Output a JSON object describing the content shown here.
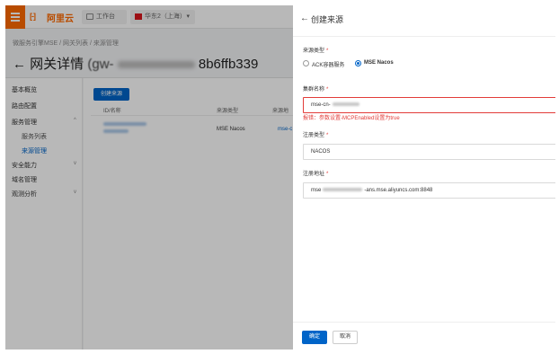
{
  "topbar": {
    "logo_mark": "[-]",
    "logo_text": "阿里云",
    "workbench": "工作台",
    "region": "华东2（上海）",
    "region_caret": "▾"
  },
  "breadcrumb": "微服务引擎MSE / 网关列表 / 来源管理",
  "page": {
    "back": "←",
    "title": "网关详情",
    "gateway_id_visible": "(gw-",
    "gateway_id_tail": "8b6ffb339"
  },
  "left_nav": {
    "items": [
      {
        "label": "基本概览"
      },
      {
        "label": "路由配置"
      },
      {
        "label": "服务管理",
        "caret": "^"
      },
      {
        "label": "服务列表"
      },
      {
        "label": "来源管理"
      },
      {
        "label": "安全能力",
        "caret": "v"
      },
      {
        "label": "域名管理"
      },
      {
        "label": "观测分析",
        "caret": "v"
      }
    ]
  },
  "content": {
    "create_button": "创建来源",
    "columns": [
      "ID/名称",
      "来源类型",
      "来源地"
    ],
    "row": {
      "type": "MSE Nacos",
      "source_prefix": "mse-c"
    }
  },
  "drawer": {
    "back": "←",
    "title": "创建来源",
    "source_type_label": "来源类型",
    "source_type_options": [
      {
        "label": "ACK容器服务",
        "checked": false
      },
      {
        "label": "MSE Nacos",
        "checked": true
      }
    ],
    "cluster_name_label": "集群名称",
    "cluster_name_value": "mse-cn-",
    "cluster_error": "报错：参数设置-MCPEnabled设置为true",
    "registry_type_label": "注册类型",
    "registry_type_value": "NACOS",
    "registry_address_label": "注册地址",
    "registry_address_prefix": "mse",
    "registry_address_suffix": "-ans.mse.aliyuncs.com:8848",
    "required_mark": "*",
    "ok_button": "确定",
    "cancel_button": "取消"
  }
}
